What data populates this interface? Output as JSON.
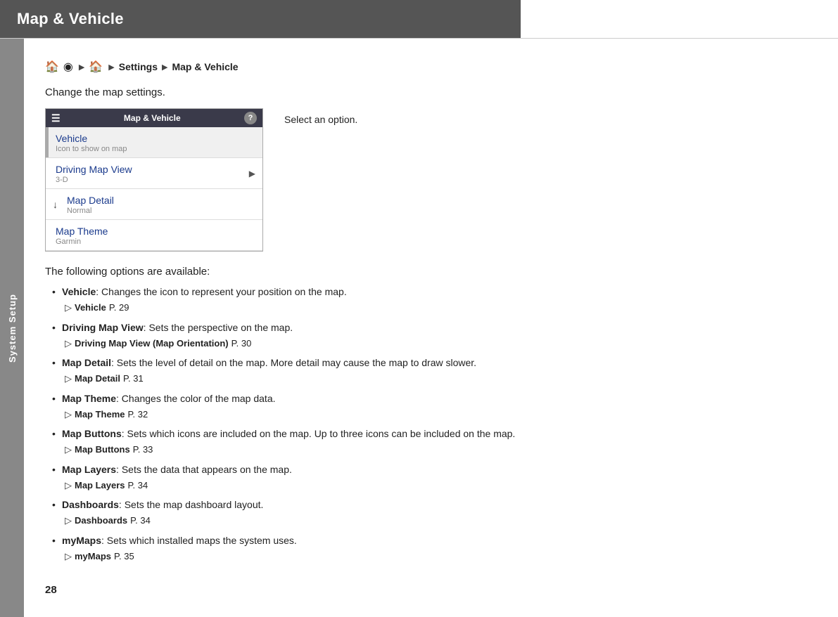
{
  "header": {
    "title": "Map & Vehicle"
  },
  "sidebar": {
    "label": "System Setup"
  },
  "breadcrumb": {
    "icons": [
      "🏠",
      "◉",
      "▶",
      "🏠",
      "▶"
    ],
    "path": "Settings ▶ Map & Vehicle"
  },
  "intro": "Change the map settings.",
  "menu": {
    "title": "Map & Vehicle",
    "help_label": "?",
    "items": [
      {
        "name": "Vehicle",
        "sub": "Icon to show on map",
        "selected": true,
        "has_left_bar": true
      },
      {
        "name": "Driving Map View",
        "sub": "3-D",
        "selected": false,
        "has_arrow": true
      },
      {
        "name": "Map Detail",
        "sub": "Normal",
        "selected": false,
        "has_down_arrow": true
      },
      {
        "name": "Map Theme",
        "sub": "Garmin",
        "selected": false
      }
    ]
  },
  "select_option_text": "Select an option.",
  "options": {
    "intro": "The following options are available:",
    "items": [
      {
        "name": "Vehicle",
        "desc": ": Changes the icon to represent your position on the map.",
        "ref_label": "Vehicle",
        "ref_page": "P. 29"
      },
      {
        "name": "Driving Map View",
        "desc": ": Sets the perspective on the map.",
        "ref_label": "Driving Map View (Map Orientation)",
        "ref_page": "P. 30"
      },
      {
        "name": "Map Detail",
        "desc": ": Sets the level of detail on the map. More detail may cause the map to draw slower.",
        "ref_label": "Map Detail",
        "ref_page": "P. 31"
      },
      {
        "name": "Map Theme",
        "desc": ": Changes the color of the map data.",
        "ref_label": "Map Theme",
        "ref_page": "P. 32"
      },
      {
        "name": "Map Buttons",
        "desc": ": Sets which icons are included on the map. Up to three icons can be included on the map.",
        "ref_label": "Map Buttons",
        "ref_page": "P. 33"
      },
      {
        "name": "Map Layers",
        "desc": ": Sets the data that appears on the map.",
        "ref_label": "Map Layers",
        "ref_page": "P. 34"
      },
      {
        "name": "Dashboards",
        "desc": ": Sets the map dashboard layout.",
        "ref_label": "Dashboards",
        "ref_page": "P. 34"
      },
      {
        "name": "myMaps",
        "desc": ": Sets which installed maps the system uses.",
        "ref_label": "myMaps",
        "ref_page": "P. 35"
      }
    ]
  },
  "page_number": "28"
}
